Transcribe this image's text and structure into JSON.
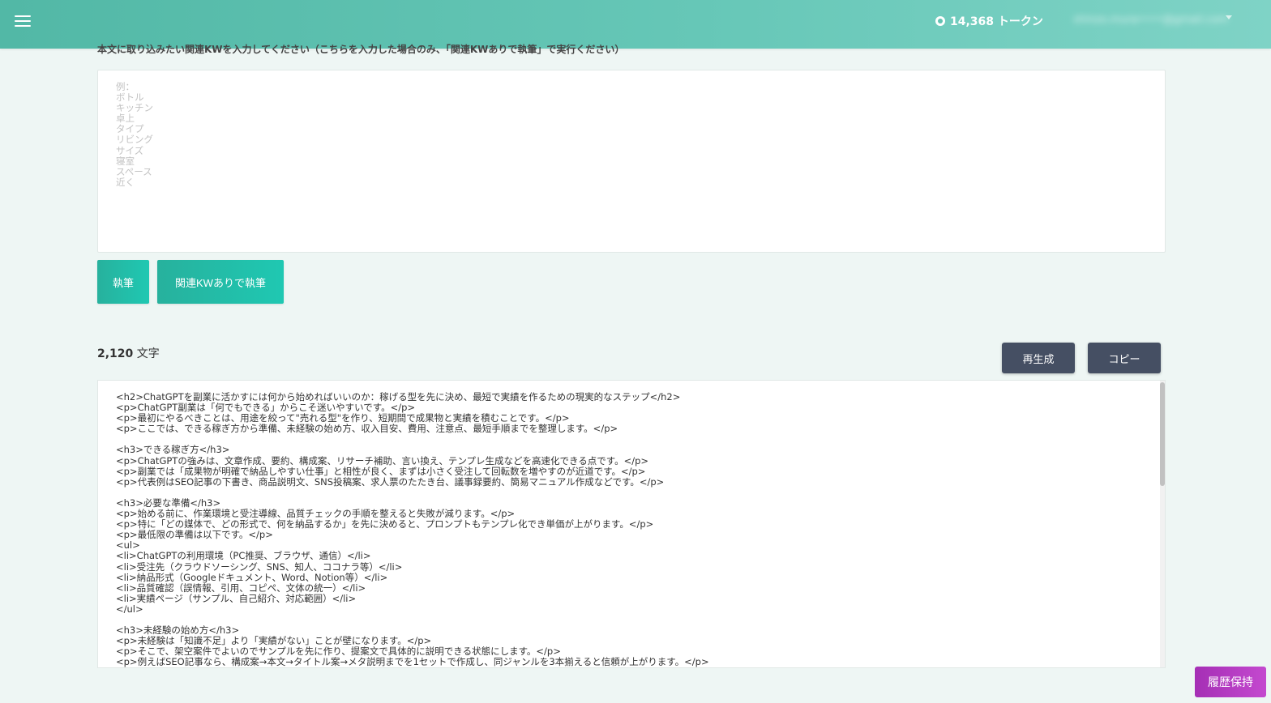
{
  "header": {
    "tokens_text": "14,368 トークン",
    "account_text": "shinzo.mura••••@gmail.com"
  },
  "form": {
    "intro_label": "本文に取り込みたい関連KWを入力してください（こちらを入力した場合のみ、「関連KWありで執筆」で実行ください）",
    "kw_placeholder": "例：\nボトル\nキッチン\n卓上\nタイプ\nリビング\nサイズ\n寝室\nスペース\n近く",
    "write_label": "執筆",
    "write_kw_label": "関連KWありで執筆"
  },
  "result": {
    "char_count": "2,120",
    "char_unit": "文字",
    "regen_label": "再生成",
    "copy_label": "コピー",
    "text": "<h2>ChatGPTを副業に活かすには何から始めればいいのか：稼げる型を先に決め、最短で実績を作るための現実的なステップ</h2>\n<p>ChatGPT副業は「何でもできる」からこそ迷いやすいです。</p>\n<p>最初にやるべきことは、用途を絞って\"売れる型\"を作り、短期間で成果物と実績を積むことです。</p>\n<p>ここでは、できる稼ぎ方から準備、未経験の始め方、収入目安、費用、注意点、最短手順までを整理します。</p>\n\n<h3>できる稼ぎ方</h3>\n<p>ChatGPTの強みは、文章作成、要約、構成案、リサーチ補助、言い換え、テンプレ生成などを高速化できる点です。</p>\n<p>副業では「成果物が明確で納品しやすい仕事」と相性が良く、まずは小さく受注して回転数を増やすのが近道です。</p>\n<p>代表例はSEO記事の下書き、商品説明文、SNS投稿案、求人票のたたき台、議事録要約、簡易マニュアル作成などです。</p>\n\n<h3>必要な準備</h3>\n<p>始める前に、作業環境と受注導線、品質チェックの手順を整えると失敗が減ります。</p>\n<p>特に「どの媒体で、どの形式で、何を納品するか」を先に決めると、プロンプトもテンプレ化でき単価が上がります。</p>\n<p>最低限の準備は以下です。</p>\n<ul>\n<li>ChatGPTの利用環境（PC推奨、ブラウザ、通信）</li>\n<li>受注先（クラウドソーシング、SNS、知人、ココナラ等）</li>\n<li>納品形式（Googleドキュメント、Word、Notion等）</li>\n<li>品質確認（誤情報、引用、コピペ、文体の統一）</li>\n<li>実績ページ（サンプル、自己紹介、対応範囲）</li>\n</ul>\n\n<h3>未経験の始め方</h3>\n<p>未経験は「知識不足」より「実績がない」ことが壁になります。</p>\n<p>そこで、架空案件でよいのでサンプルを先に作り、提案文で具体的に説明できる状態にします。</p>\n<p>例えばSEO記事なら、構成案→本文→タイトル案→メタ説明までを1セットで作成し、同ジャンルを3本揃えると信頼が上がります。</p>\n<p>最初は単価より実績と評価を優先し、納品の流れに慣れることが大切です。</p>"
  },
  "history_label": "履歴保持"
}
